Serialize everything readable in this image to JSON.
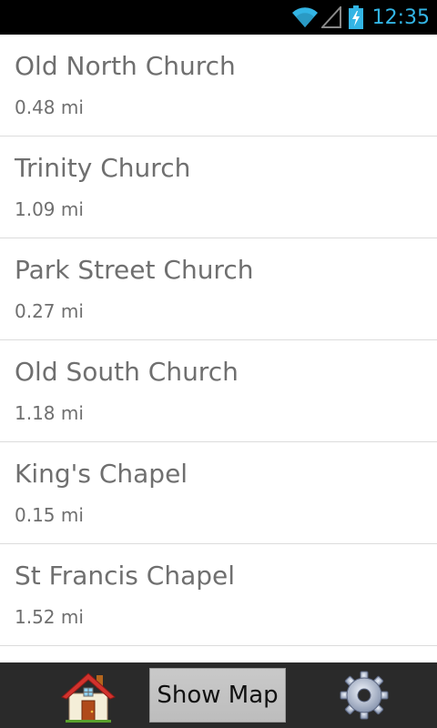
{
  "status_bar": {
    "time": "12:35",
    "icons": [
      "wifi-icon",
      "signal-icon",
      "battery-charging-icon"
    ],
    "accent_color": "#33b5e5"
  },
  "list": {
    "items": [
      {
        "name": "Old North Church",
        "distance": "0.48 mi"
      },
      {
        "name": "Trinity Church",
        "distance": "1.09 mi"
      },
      {
        "name": "Park Street Church",
        "distance": "0.27 mi"
      },
      {
        "name": "Old South Church",
        "distance": "1.18 mi"
      },
      {
        "name": "King's Chapel",
        "distance": "0.15 mi"
      },
      {
        "name": "St Francis Chapel",
        "distance": "1.52 mi"
      }
    ]
  },
  "bottom_bar": {
    "home_icon": "home-icon",
    "show_map_label": "Show Map",
    "settings_icon": "gear-icon"
  }
}
